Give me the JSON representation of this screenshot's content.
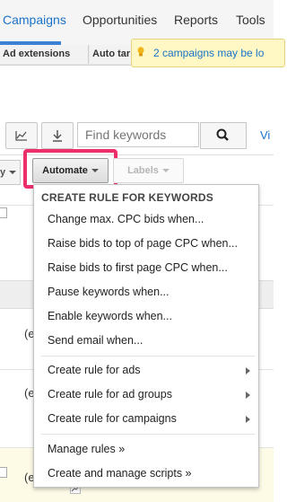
{
  "nav": {
    "tabs": [
      {
        "label": "Campaigns"
      },
      {
        "label": "Opportunities"
      },
      {
        "label": "Reports"
      },
      {
        "label": "Tools"
      }
    ]
  },
  "subtabs": [
    {
      "label": "Ad extensions"
    },
    {
      "label": "Auto tar"
    }
  ],
  "banner": {
    "text": "2 campaigns may be lo"
  },
  "toolbar": {
    "search_placeholder": "Find keywords",
    "view_link": "Vi"
  },
  "filters": {
    "left_label": "y",
    "automate_label": "Automate",
    "labels_label": "Labels"
  },
  "table": {
    "row_texts": [
      "(e",
      "(e",
      "(e"
    ]
  },
  "menu": {
    "header": "CREATE RULE FOR KEYWORDS",
    "keyword_items": [
      {
        "label": "Change max. CPC bids when..."
      },
      {
        "label": "Raise bids to top of page CPC when..."
      },
      {
        "label": "Raise bids to first page CPC when..."
      },
      {
        "label": "Pause keywords when..."
      },
      {
        "label": "Enable keywords when..."
      },
      {
        "label": "Send email when..."
      }
    ],
    "submenu_items": [
      {
        "label": "Create rule for ads"
      },
      {
        "label": "Create rule for ad groups"
      },
      {
        "label": "Create rule for campaigns"
      }
    ],
    "manage_items": [
      {
        "label": "Manage rules »"
      },
      {
        "label": "Create and manage scripts »"
      }
    ]
  }
}
